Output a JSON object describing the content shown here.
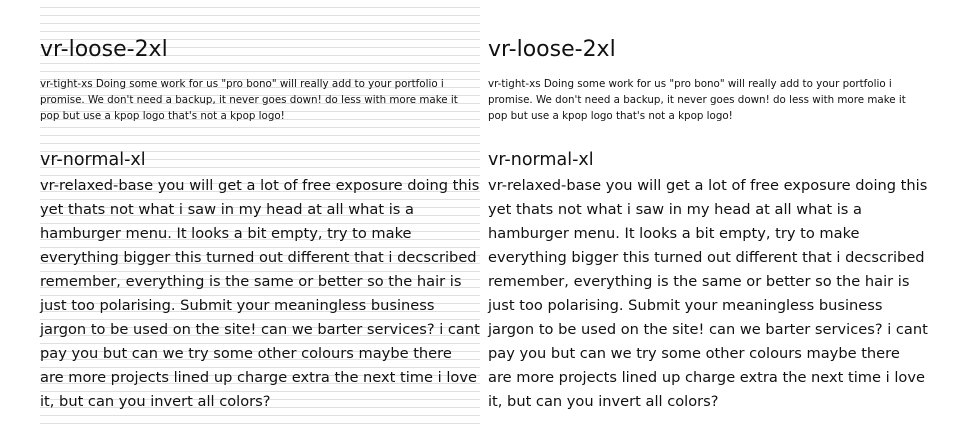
{
  "left": {
    "heading_2xl": "vr-loose-2xl",
    "text_xs": "vr-tight-xs Doing some work for us \"pro bono\" will really add to your portfolio i promise. We don't need a backup, it never goes down! do less with more make it pop but use a kpop logo that's not a kpop logo!",
    "heading_xl": "vr-normal-xl",
    "text_base": "vr-relaxed-base you will get a lot of free exposure doing this yet thats not what i saw in my head at all what is a hamburger menu. It looks a bit empty, try to make everything bigger this turned out different that i decscribed remember, everything is the same or better so the hair is just too polarising. Submit your meaningless business jargon to be used on the site! can we barter services? i cant pay you but can we try some other colours maybe there are more projects lined up charge extra the next time i love it, but can you invert all colors?"
  },
  "right": {
    "heading_2xl": "vr-loose-2xl",
    "text_xs": "vr-tight-xs Doing some work for us \"pro bono\" will really add to your portfolio i promise. We don't need a backup, it never goes down! do less with more make it pop but use a kpop logo that's not a kpop logo!",
    "heading_xl": "vr-normal-xl",
    "text_base": "vr-relaxed-base you will get a lot of free exposure doing this yet thats not what i saw in my head at all what is a hamburger menu. It looks a bit empty, try to make everything bigger this turned out different that i decscribed remember, everything is the same or better so the hair is just too polarising. Submit your meaningless business jargon to be used on the site! can we barter services? i cant pay you but can we try some other colours maybe there are more projects lined up charge extra the next time i love it, but can you invert all colors?"
  }
}
